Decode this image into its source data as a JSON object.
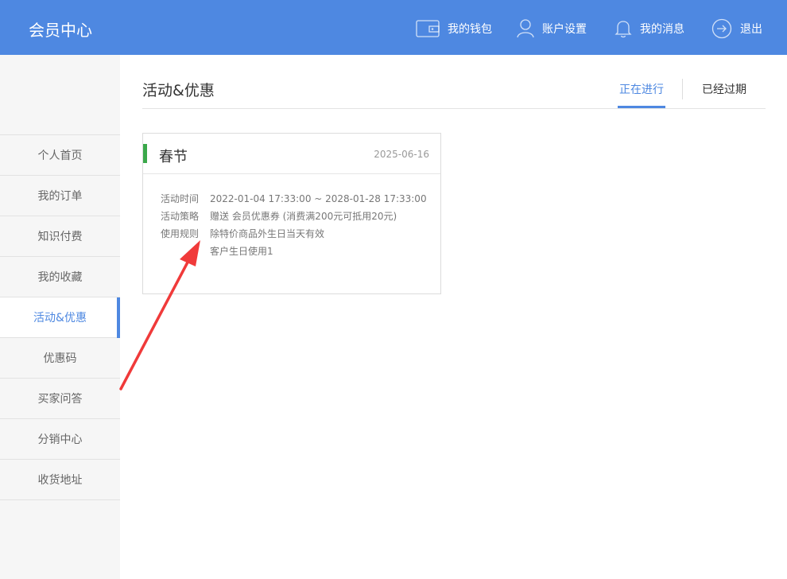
{
  "header": {
    "brand": "会员中心",
    "nav": [
      {
        "label": "我的钱包",
        "icon": "wallet-icon"
      },
      {
        "label": "账户设置",
        "icon": "user-icon"
      },
      {
        "label": "我的消息",
        "icon": "bell-icon"
      },
      {
        "label": "退出",
        "icon": "logout-icon"
      }
    ]
  },
  "sidebar": {
    "items": [
      {
        "label": "个人首页"
      },
      {
        "label": "我的订单"
      },
      {
        "label": "知识付费"
      },
      {
        "label": "我的收藏"
      },
      {
        "label": "活动&优惠",
        "active": true
      },
      {
        "label": "优惠码"
      },
      {
        "label": "买家问答"
      },
      {
        "label": "分销中心"
      },
      {
        "label": "收货地址"
      }
    ]
  },
  "main": {
    "title": "活动&优惠",
    "tabs": [
      {
        "label": "正在进行",
        "active": true
      },
      {
        "label": "已经过期"
      }
    ],
    "card": {
      "title": "春节",
      "date": "2025-06-16",
      "rows": [
        {
          "label": "活动时间",
          "value": "2022-01-04 17:33:00 ~ 2028-01-28 17:33:00"
        },
        {
          "label": "活动策略",
          "value": "赠送 会员优惠券 (消费满200元可抵用20元)"
        },
        {
          "label": "使用规则",
          "value": "除特价商品外生日当天有效"
        },
        {
          "label": "",
          "value": "客户生日使用1"
        }
      ]
    }
  },
  "colors": {
    "accent": "#4e88e1",
    "marker": "#3aa84a",
    "annotation": "#f03a3a"
  }
}
